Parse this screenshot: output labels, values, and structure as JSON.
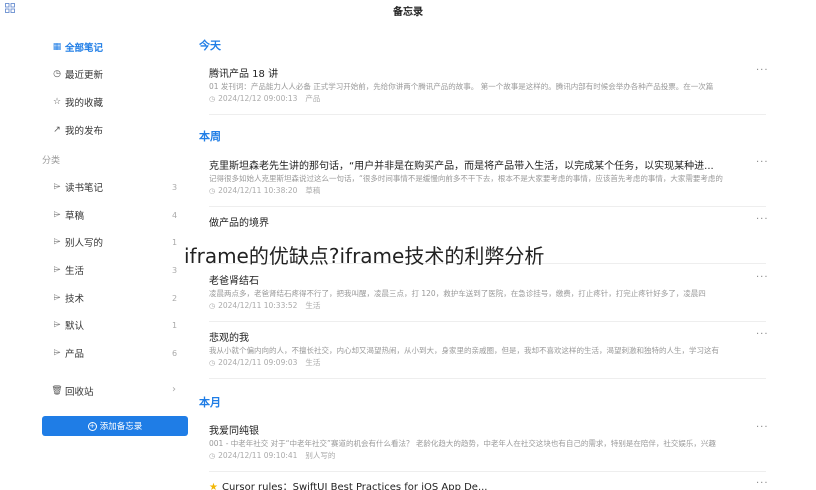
{
  "app": {
    "title": "备忘录"
  },
  "sidebar": {
    "items": [
      {
        "label": "全部笔记",
        "icon": "notes-icon"
      },
      {
        "label": "最近更新",
        "icon": "clock-icon"
      },
      {
        "label": "我的收藏",
        "icon": "star-icon"
      },
      {
        "label": "我的发布",
        "icon": "share-icon"
      }
    ],
    "category_header": "分类",
    "categories": [
      {
        "label": "读书笔记",
        "count": "3"
      },
      {
        "label": "草稿",
        "count": "4"
      },
      {
        "label": "别人写的",
        "count": "1"
      },
      {
        "label": "生活",
        "count": "3"
      },
      {
        "label": "技术",
        "count": "2"
      },
      {
        "label": "默认",
        "count": "1"
      },
      {
        "label": "产品",
        "count": "6"
      }
    ],
    "trash": "回收站",
    "add_button": "添加备忘录"
  },
  "sections": [
    {
      "title": "今天"
    },
    {
      "title": "本周"
    },
    {
      "title": "本月"
    }
  ],
  "notes": [
    {
      "title": "腾讯产品 18 讲",
      "snippet": "01 发刊词：产品能力人人必备 正式学习开始前，先给你讲两个腾讯产品的故事。 第一个故事是这样的。腾讯内部有时候会举办各种产品投票。在一次篇",
      "time": "2024/12/12 09:00:13",
      "tag": "产品"
    },
    {
      "title": "克里斯坦森老先生讲的那句话，“用户并非是在购买产品，而是将产品带入生活，以完成某个任务，以实现某种进...",
      "snippet": "记得很多如始人克里斯坦森说过这么一句话，“很多时间事情不是缓慢向前多不干下去，根本不是大家要考虑的事情，应该首先考虑的事情，大家需要考虑的",
      "time": "2024/12/11 10:38:20",
      "tag": "草稿"
    },
    {
      "title": "做产品的境界",
      "snippet": "",
      "time": "",
      "tag": ""
    },
    {
      "title": "老爸肾结石",
      "snippet": "凌晨两点多，老爸肾结石疼得不行了，把我叫醒，凌晨三点，打 120，救护车送到了医院，在急诊挂号，缴费，打止疼针，打完止疼针好多了，凌晨四",
      "time": "2024/12/11 10:33:52",
      "tag": "生活"
    },
    {
      "title": "悲观的我",
      "snippet": "我从小就个偏内向的人，不擅长社交，内心却又渴望热闹，从小到大，身家里的亲戚圈，但是，我却不喜欢这样的生活，渴望刺激和独特的人生，学习这有",
      "time": "2024/12/11 09:09:03",
      "tag": "生活"
    },
    {
      "title": "我爱同纯银",
      "snippet": "001 - 中老年社交 对于“中老年社交”赛道的机会有什么看法？ 老龄化趋大的趋势，中老年人在社交这块也有自己的需求，特别是在陪伴，社交娱乐，兴趣",
      "time": "2024/12/11 09:10:41",
      "tag": "别人写的"
    },
    {
      "title": "Cursor rules：SwiftUI Best Practices for iOS App De...",
      "snippet": "",
      "time": "",
      "tag": ""
    }
  ],
  "overlay": {
    "text": "iframe的优缺点?iframe技术的利弊分析"
  },
  "colors": {
    "accent": "#1f7de6",
    "star": "#f2b705"
  }
}
